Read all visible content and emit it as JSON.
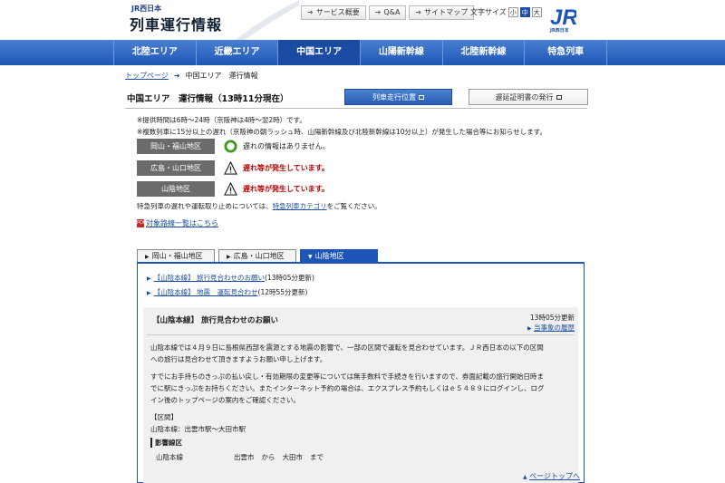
{
  "header": {
    "brand_small": "JR西日本",
    "brand_title": "列車運行情報",
    "utility_links": [
      "サービス概要",
      "Q&A",
      "サイトマップ"
    ],
    "font_size_label": "文字サイズ",
    "font_sizes": [
      "小",
      "中",
      "大"
    ],
    "logo_text": "JR西日本"
  },
  "nav": {
    "items": [
      "北陸エリア",
      "近畿エリア",
      "中国エリア",
      "山陽新幹線",
      "北陸新幹線",
      "特急列車"
    ],
    "active": "中国エリア"
  },
  "breadcrumb": {
    "home": "トップページ",
    "current": "中国エリア　運行情報"
  },
  "page": {
    "title": "中国エリア　運行情報（13時11分現在）",
    "btn_train_position": "列車走行位置",
    "btn_delay_cert": "遅延証明書の発行"
  },
  "notes": [
    "※提供時間は6時〜24時（京阪神は4時〜翌2時）です。",
    "※複数列車に15分以上の遅れ（京阪神の朝ラッシュ時、山陽新幹線及び北陸新幹線は10分以上）が発生した場合等にお知らせします。"
  ],
  "status": [
    {
      "region": "岡山・福山地区",
      "icon": "circle-ok-icon",
      "text": "遅れの情報はありません。",
      "level": "ok"
    },
    {
      "region": "広島・山口地区",
      "icon": "warning-icon",
      "text": "遅れ等が発生しています。",
      "level": "warn"
    },
    {
      "region": "山陰地区",
      "icon": "warning-icon",
      "text": "遅れ等が発生しています。",
      "level": "warn"
    }
  ],
  "limited_express_note": {
    "prefix": "特急列車の遅れや運転取り止めについては、",
    "link": "特急列車カテゴリ",
    "suffix": "をご覧ください。"
  },
  "pdf_link": "対象路線一覧はこちら",
  "tabs": [
    "岡山・福山地区",
    "広島・山口地区",
    "山陰地区"
  ],
  "active_tab": "山陰地区",
  "links": [
    {
      "text": "【山陰本線】 旅行見合わせのお願い",
      "time": "(13時05分更新)"
    },
    {
      "text": "【山陰本線】 地震　運転見合わせ",
      "time": "(12時55分更新)"
    }
  ],
  "detail": {
    "title": "【山陰本線】 旅行見合わせのお願い",
    "updated": "13時05分更新",
    "history_link": "当事象の履歴",
    "para1_l1": "山陰本線では４月９日に島根県西部を震源とする地震の影響で、一部の区間で運転を見合わせています。ＪＲ西日本の以下の区間",
    "para1_l2": "への旅行は見合わせて頂きますようお願い申し上げます。",
    "para2_l1": "すでにお手持ちのきっぷの払い戻し・有効期限の変更等については無手数料で手続きを行いますので、券面記載の旅行開始日時ま",
    "para2_l2": "でに駅にきっぷをお持ちください。またインターネット予約の場合は、エクスプレス予約もしくはｅ５４８９にログインし、ログ",
    "para2_l3": "イン後のトップページの案内をご確認ください。",
    "section_label": "【区間】",
    "section_value": "山陰本線：出雲市駅〜大田市駅",
    "affected_label": "影響線区",
    "affected_line": "山陰本線",
    "affected_from": "出雲市",
    "affected_kara": "から",
    "affected_to": "大田市",
    "affected_made": "まで"
  },
  "page_top": "ページトップへ",
  "colors": {
    "nav_blue": "#1e56b8",
    "warn_red": "#c00000",
    "ok_green": "#3a9a1e"
  }
}
